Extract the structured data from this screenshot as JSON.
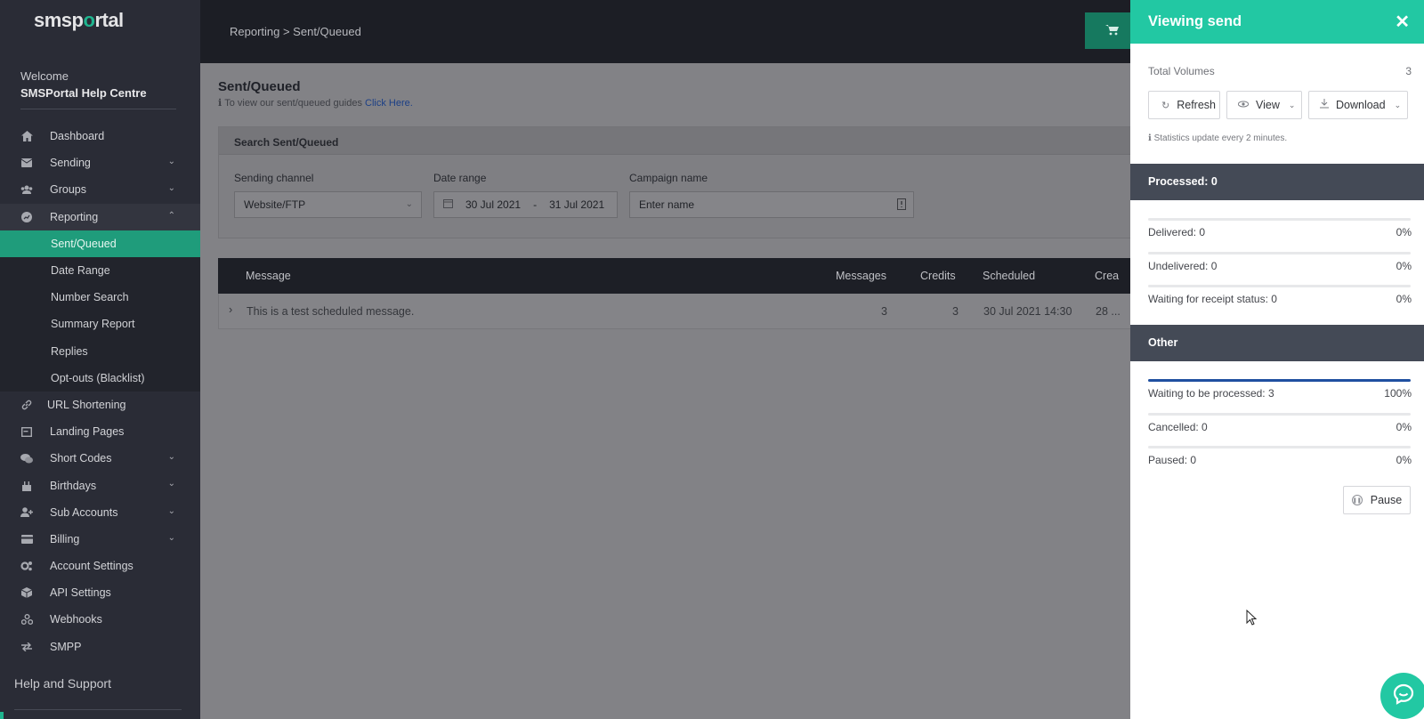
{
  "brand": {
    "logo_pre": "smsp",
    "logo_o": "o",
    "logo_post": "rtal",
    "accent": "#1fb58f"
  },
  "sidebar": {
    "welcome": "Welcome",
    "account": "SMSPortal Help Centre",
    "items": [
      {
        "label": "Dashboard",
        "icon": "home-icon"
      },
      {
        "label": "Sending",
        "icon": "envelope-icon"
      },
      {
        "label": "Groups",
        "icon": "users-icon"
      },
      {
        "label": "Reporting",
        "icon": "chart-icon"
      },
      {
        "label": "URL Shortening",
        "icon": "link-icon"
      },
      {
        "label": "Landing Pages",
        "icon": "page-icon"
      },
      {
        "label": "Short Codes",
        "icon": "chat-icon"
      },
      {
        "label": "Birthdays",
        "icon": "cake-icon"
      },
      {
        "label": "Sub Accounts",
        "icon": "user-plus-icon"
      },
      {
        "label": "Billing",
        "icon": "card-icon"
      },
      {
        "label": "Account Settings",
        "icon": "cogs-icon"
      },
      {
        "label": "API Settings",
        "icon": "cube-icon"
      },
      {
        "label": "Webhooks",
        "icon": "webhook-icon"
      },
      {
        "label": "SMPP",
        "icon": "exchange-icon"
      }
    ],
    "reporting_sub": [
      "Sent/Queued",
      "Date Range",
      "Number Search",
      "Summary Report",
      "Replies",
      "Opt-outs (Blacklist)"
    ],
    "help": "Help and Support"
  },
  "header": {
    "breadcrumb": "Reporting > Sent/Queued"
  },
  "main": {
    "title": "Sent/Queued",
    "guide_text": "To view our sent/queued guides",
    "guide_link": "Click Here.",
    "search_title": "Search Sent/Queued",
    "channel_label": "Sending channel",
    "channel_value": "Website/FTP",
    "date_label": "Date range",
    "date_from": "30 Jul 2021",
    "date_sep": "-",
    "date_to": "31 Jul 2021",
    "campaign_label": "Campaign name",
    "campaign_placeholder": "Enter name",
    "table": {
      "headers": {
        "message": "Message",
        "messages": "Messages",
        "credits": "Credits",
        "scheduled": "Scheduled",
        "created": "Crea"
      },
      "row": {
        "message": "This is a test scheduled message.",
        "messages": "3",
        "credits": "3",
        "scheduled": "30 Jul 2021 14:30",
        "created": "28 ..."
      }
    }
  },
  "panel": {
    "title": "Viewing send",
    "total_label": "Total Volumes",
    "total_value": "3",
    "refresh": "Refresh",
    "view": "View",
    "download": "Download",
    "note": "Statistics update every 2 minutes.",
    "processed_title": "Processed: 0",
    "processed": [
      {
        "label": "Delivered: 0",
        "pct": "0%",
        "fill": 0
      },
      {
        "label": "Undelivered: 0",
        "pct": "0%",
        "fill": 0
      },
      {
        "label": "Waiting for receipt status: 0",
        "pct": "0%",
        "fill": 0
      }
    ],
    "other_title": "Other",
    "other": [
      {
        "label": "Waiting to be processed: 3",
        "pct": "100%",
        "fill": 1
      },
      {
        "label": "Cancelled: 0",
        "pct": "0%",
        "fill": 0
      },
      {
        "label": "Paused: 0",
        "pct": "0%",
        "fill": 0
      }
    ],
    "pause": "Pause",
    "header_color": "#22c8a3"
  }
}
